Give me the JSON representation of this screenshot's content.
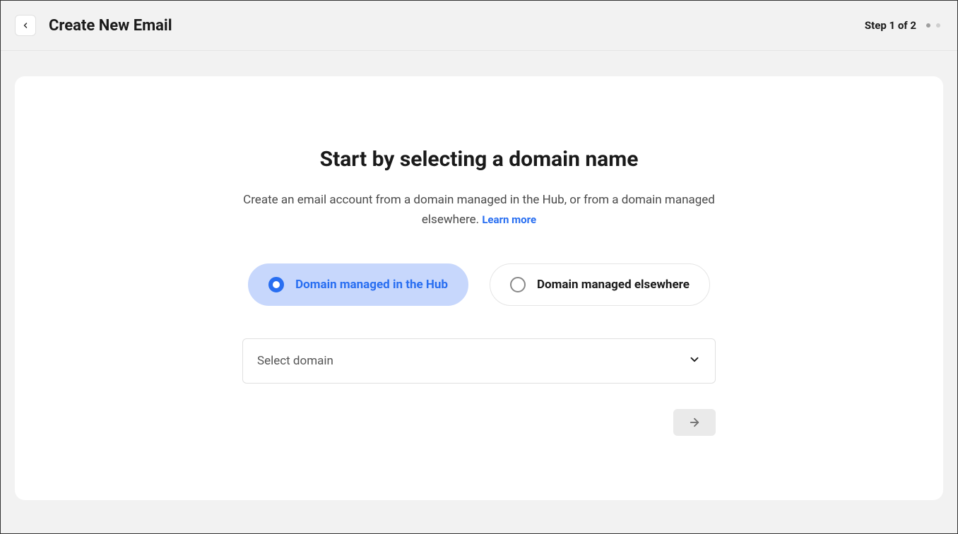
{
  "header": {
    "title": "Create New Email",
    "step_label": "Step 1 of 2"
  },
  "main": {
    "heading": "Start by selecting a domain name",
    "description_part1": "Create an email account from a domain managed in the Hub, or from a domain managed elsewhere. ",
    "learn_more": "Learn more"
  },
  "options": {
    "hub": "Domain managed in the Hub",
    "elsewhere": "Domain managed elsewhere"
  },
  "select": {
    "placeholder": "Select domain"
  }
}
